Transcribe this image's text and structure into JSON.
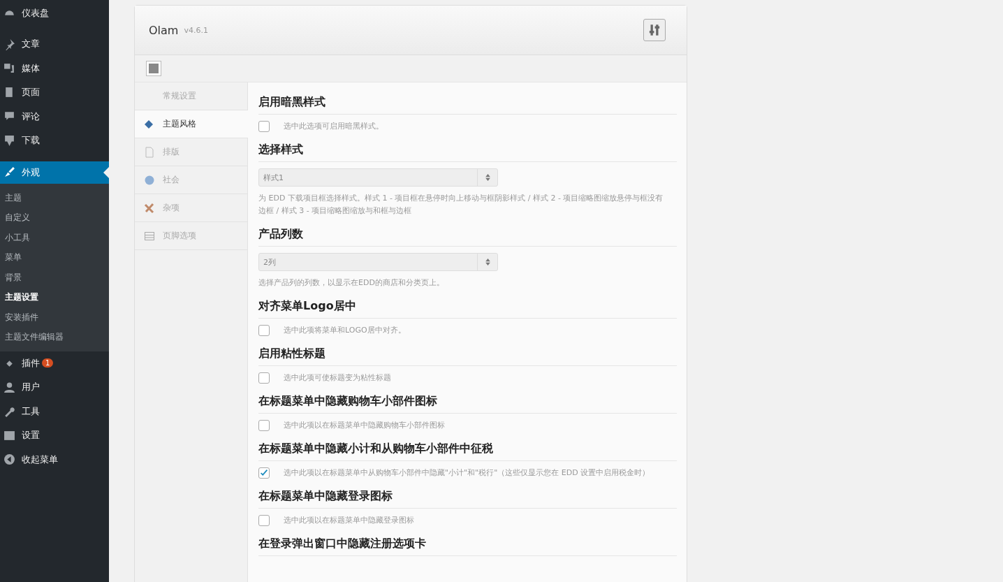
{
  "menu": [
    {
      "label": "仪表盘",
      "selected": false
    },
    {
      "label": "文章",
      "selected": false
    },
    {
      "label": "媒体",
      "selected": false
    },
    {
      "label": "页面",
      "selected": false
    },
    {
      "label": "评论",
      "selected": false
    },
    {
      "label": "下载",
      "selected": false
    },
    {
      "label": "外观",
      "selected": true,
      "children": [
        {
          "label": "主题",
          "selected": false
        },
        {
          "label": "自定义",
          "selected": false
        },
        {
          "label": "小工具",
          "selected": false
        },
        {
          "label": "菜单",
          "selected": false
        },
        {
          "label": "背景",
          "selected": false
        },
        {
          "label": "主题设置",
          "selected": true
        },
        {
          "label": "安装插件",
          "selected": false
        },
        {
          "label": "主题文件编辑器",
          "selected": false
        }
      ]
    },
    {
      "label": "插件",
      "selected": false,
      "badge": "1"
    },
    {
      "label": "用户",
      "selected": false
    },
    {
      "label": "工具",
      "selected": false
    },
    {
      "label": "设置",
      "selected": false
    },
    {
      "label": "收起菜单",
      "selected": false
    }
  ],
  "panel": {
    "title": "Olam",
    "version": "v4.6.1",
    "tabs": [
      {
        "label": "常规设置",
        "selected": false
      },
      {
        "label": "主题风格",
        "selected": true
      },
      {
        "label": "排版",
        "selected": false
      },
      {
        "label": "社会",
        "selected": false
      },
      {
        "label": "杂项",
        "selected": false
      },
      {
        "label": "页脚选项",
        "selected": false
      }
    ],
    "options": [
      {
        "kind": "checkbox",
        "heading": "启用暗黑样式",
        "checked": false,
        "description": "选中此选项可启用暗黑样式。"
      },
      {
        "kind": "select",
        "heading": "选择样式",
        "value": "样式1",
        "description": "为 EDD 下载项目框选择样式。样式 1 - 项目框在悬停时向上移动与框阴影样式 / 样式 2 - 项目缩略图缩放悬停与框没有边框 / 样式 3 - 项目缩略图缩放与和框与边框"
      },
      {
        "kind": "select",
        "heading": "产品列数",
        "value": "2列",
        "description": "选择产品列的列数，以显示在EDD的商店和分类页上。"
      },
      {
        "kind": "checkbox",
        "heading": "对齐菜单Logo居中",
        "checked": false,
        "description": "选中此项将菜单和LOGO居中对齐。"
      },
      {
        "kind": "checkbox",
        "heading": "启用粘性标题",
        "checked": false,
        "description": "选中此项可使标题变为粘性标题"
      },
      {
        "kind": "checkbox",
        "heading": "在标题菜单中隐藏购物车小部件图标",
        "checked": false,
        "description": "选中此项以在标题菜单中隐藏购物车小部件图标"
      },
      {
        "kind": "checkbox",
        "heading": "在标题菜单中隐藏小计和从购物车小部件中征税",
        "checked": true,
        "description": "选中此项以在标题菜单中从购物车小部件中隐藏\"小计\"和\"税行\"（这些仅显示您在 EDD 设置中启用税金时）"
      },
      {
        "kind": "checkbox",
        "heading": "在标题菜单中隐藏登录图标",
        "checked": false,
        "description": "选中此项以在标题菜单中隐藏登录图标"
      },
      {
        "kind": "heading",
        "heading": "在登录弹出窗口中隐藏注册选项卡"
      }
    ]
  }
}
